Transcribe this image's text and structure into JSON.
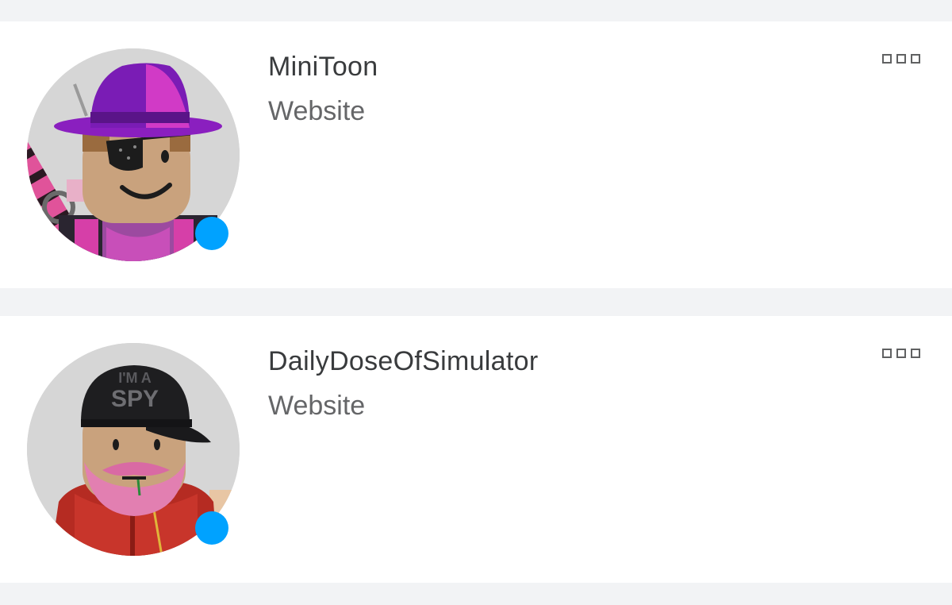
{
  "entries": [
    {
      "name": "MiniToon",
      "subtitle": "Website",
      "avatar_icon": "roblox-avatar-purple-fedora",
      "presence_color": "#00a2ff"
    },
    {
      "name": "DailyDoseOfSimulator",
      "subtitle": "Website",
      "avatar_icon": "roblox-avatar-black-cap",
      "cap_text_top": "I'M A",
      "cap_text_bottom": "SPY",
      "presence_color": "#00a2ff"
    }
  ],
  "colors": {
    "page_background": "#f2f3f5",
    "card_background": "#ffffff",
    "name_text": "#393b3d",
    "subtitle_text": "#656668",
    "online_indicator": "#00a2ff"
  }
}
